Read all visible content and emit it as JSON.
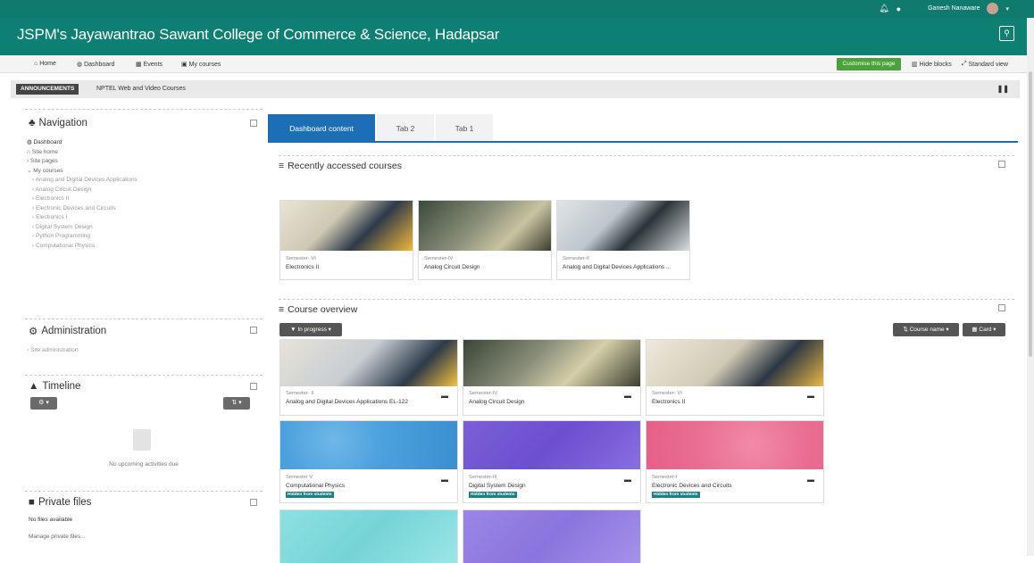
{
  "topbar": {
    "user_name": "Ganesh Nanaware"
  },
  "header": {
    "site_title": "JSPM's Jayawantrao Sawant College of Commerce & Science, Hadapsar"
  },
  "navbar": {
    "items": [
      "Home",
      "Dashboard",
      "Events",
      "My courses"
    ],
    "customise_label": "Customise this page",
    "hide_blocks_label": "Hide blocks",
    "standard_view_label": "Standard view"
  },
  "announcement": {
    "label": "ANNOUNCEMENTS",
    "text": "NPTEL Web and Video Courses"
  },
  "navigation": {
    "title": "Navigation",
    "dashboard": "Dashboard",
    "site_home": "Site home",
    "site_pages": "Site pages",
    "my_courses": "My courses",
    "courses": [
      "Analog and Digital Devices Applications",
      "Analog Circuit Design",
      "Electronics II",
      "Electronic Devices and Circuits",
      "Electronics I",
      "Digital System Design",
      "Python Programming",
      "Computational Physics"
    ]
  },
  "administration": {
    "title": "Administration",
    "item": "Site administration"
  },
  "timeline": {
    "title": "Timeline",
    "empty_text": "No upcoming activities due"
  },
  "private_files": {
    "title": "Private files",
    "none": "No files available",
    "manage": "Manage private files..."
  },
  "tabs": [
    "Dashboard content",
    "Tab 2",
    "Tab 1"
  ],
  "recent": {
    "title": "Recently accessed courses",
    "cards": [
      {
        "semester": "Semester- VI",
        "name": "Electronics II"
      },
      {
        "semester": "Semester-IV",
        "name": "Analog Circuit Design"
      },
      {
        "semester": "Semester-II",
        "name": "Analog and Digital Devices Applications ..."
      }
    ]
  },
  "overview": {
    "title": "Course overview",
    "filter_label": "In progress",
    "sort_label": "Course name",
    "view_label": "Card",
    "cards": [
      {
        "semester": "Semester- II",
        "name": "Analog and Digital Devices Applications EL-122"
      },
      {
        "semester": "Semester-IV",
        "name": "Analog Circuit Design"
      },
      {
        "semester": "Semester- VI",
        "name": "Electronics II"
      },
      {
        "semester": "Semester V",
        "name": "Computational Physics",
        "badge": "Hidden from students"
      },
      {
        "semester": "Semester-III",
        "name": "Digital System Design",
        "badge": "Hidden from students"
      },
      {
        "semester": "Semester-I",
        "name": "Electronic Devices and Circuits",
        "badge": "Hidden from students"
      }
    ]
  },
  "colors": {
    "brand": "#0d7f73",
    "tab_active": "#1c6fb4",
    "customise": "#4aa338",
    "badge": "#1e7f89"
  }
}
